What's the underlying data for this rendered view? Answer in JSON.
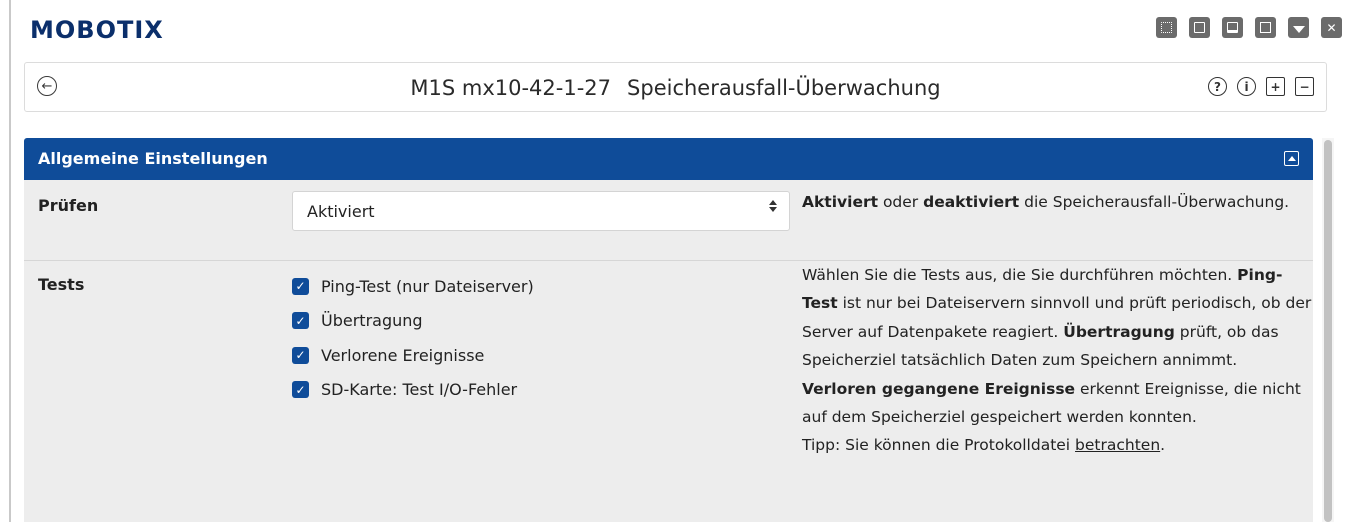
{
  "brand": {
    "logo": "MOBOTIX"
  },
  "toolbar": {
    "icons": [
      "grid-icon",
      "windows-icon",
      "window-icon",
      "save-icon",
      "dropdown-icon",
      "close-icon"
    ]
  },
  "header": {
    "camera": "M1S mx10-42-1-27",
    "title": "Speicherausfall-Überwachung",
    "icons": [
      "back-icon",
      "help-icon",
      "info-icon",
      "expand-icon",
      "collapse-icon"
    ]
  },
  "section": {
    "title": "Allgemeine Einstellungen",
    "rows": {
      "pruefen": {
        "label": "Prüfen",
        "select_value": "Aktiviert",
        "desc": {
          "b1": "Aktiviert",
          "t1": " oder ",
          "b2": "deaktiviert",
          "t2": " die Speicherausfall-Überwachung."
        }
      },
      "tests": {
        "label": "Tests",
        "checkboxes": [
          {
            "label": "Ping-Test (nur Dateiserver)",
            "checked": true
          },
          {
            "label": "Übertragung",
            "checked": true
          },
          {
            "label": "Verlorene Ereignisse",
            "checked": true
          },
          {
            "label": "SD-Karte: Test I/O-Fehler",
            "checked": true
          }
        ],
        "desc": {
          "t1": "Wählen Sie die Tests aus, die Sie durchführen möchten. ",
          "b1": "Ping-Test",
          "t2": " ist nur bei Dateiservern sinnvoll und prüft periodisch, ob der Server auf Datenpakete reagiert. ",
          "b2": "Übertragung",
          "t3": " prüft, ob das Speicherziel tatsächlich Daten zum Speichern annimmt. ",
          "b3": "Verloren gegangene Ereignisse",
          "t4": " erkennt Ereignisse, die nicht auf dem Speicherziel gespeichert werden konnten.",
          "tip": "Tipp: Sie können die Protokolldatei ",
          "link": "betrachten",
          "end": "."
        }
      }
    }
  },
  "colors": {
    "accent": "#0f4c99",
    "logo": "#0b2f6b",
    "panel_bg": "#ededed"
  }
}
